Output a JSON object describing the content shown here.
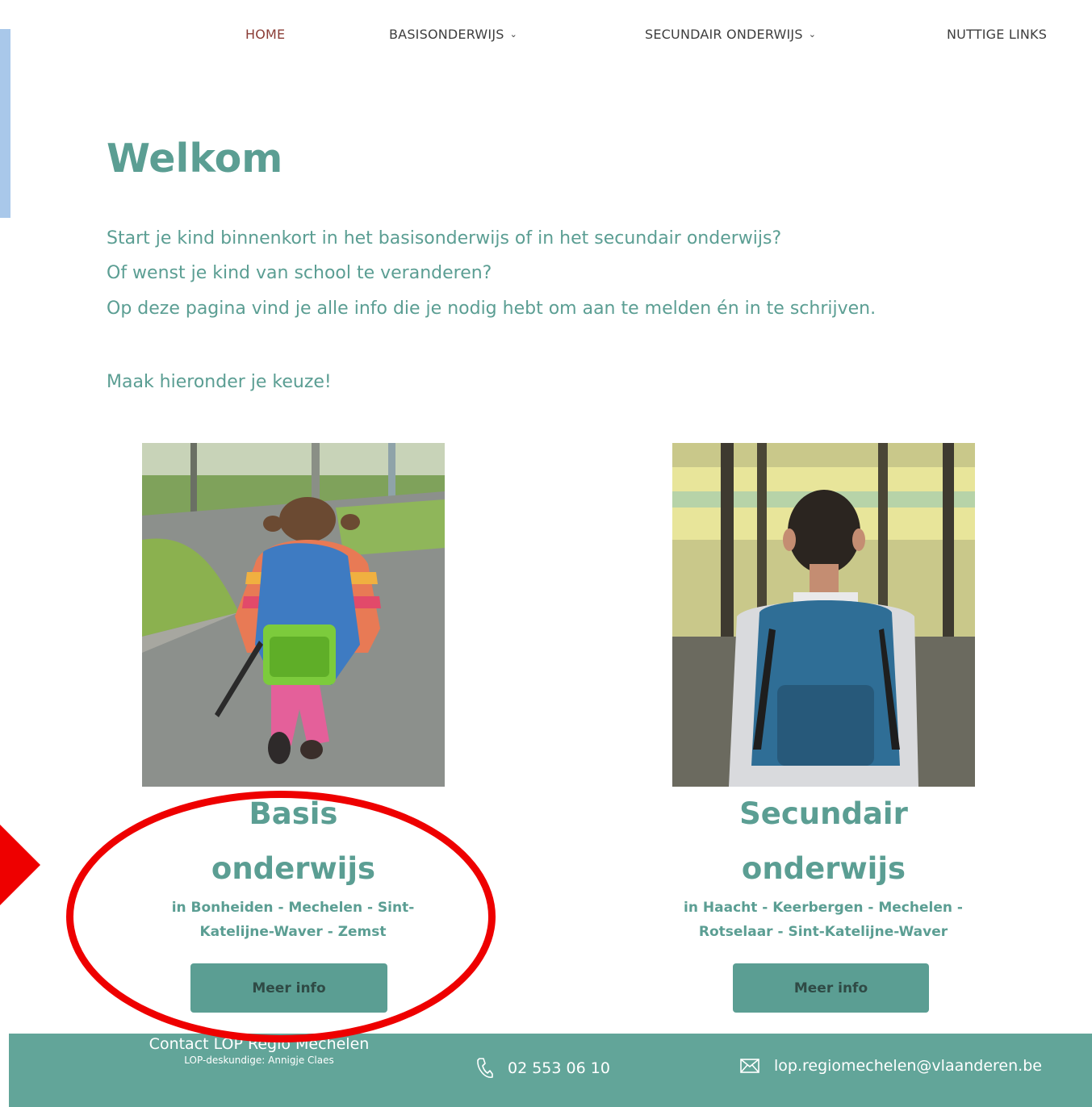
{
  "nav": {
    "items": [
      {
        "label": "HOME",
        "dropdown": false,
        "active": true
      },
      {
        "label": "BASISONDERWIJS",
        "dropdown": true,
        "active": false
      },
      {
        "label": "SECUNDAIR ONDERWIJS",
        "dropdown": true,
        "active": false
      },
      {
        "label": "NUTTIGE LINKS",
        "dropdown": false,
        "active": false
      }
    ],
    "chevron": "⌄"
  },
  "welcome": {
    "title": "Welkom",
    "lines": [
      "Start je kind binnenkort in het basisonderwijs of in het secundair onderwijs?",
      "Of wenst je kind van school te veranderen?",
      "Op deze pagina vind je alle info die je nodig hebt om aan te melden én in te schrijven."
    ],
    "choice": "Maak hieronder je keuze!"
  },
  "cards": [
    {
      "title_line1": "Basis",
      "title_line2": "onderwijs",
      "sub_line1": "in Bonheiden - Mechelen - Sint-",
      "sub_line2": "Katelijne-Waver - Zemst",
      "button": "Meer info",
      "image": "girl-with-backpack-photo"
    },
    {
      "title_line1": "Secundair",
      "title_line2": "onderwijs",
      "sub_line1": "in Haacht - Keerbergen - Mechelen -",
      "sub_line2": "Rotselaar - Sint-Katelijne-Waver",
      "button": "Meer info",
      "image": "boy-with-backpack-photo"
    }
  ],
  "footer": {
    "contact_title": "Contact LOP Regio Mechelen",
    "contact_sub": "LOP-deskundige: Annigje Claes",
    "phone": "02 553 06 10",
    "email": "lop.regiomechelen@vlaanderen.be",
    "phone_icon": "phone-icon",
    "mail_icon": "mail-icon"
  },
  "colors": {
    "accent": "#5b9e93",
    "footer_bg": "#62a599",
    "nav_active": "#8a3c35",
    "annotation": "#ee0000"
  }
}
